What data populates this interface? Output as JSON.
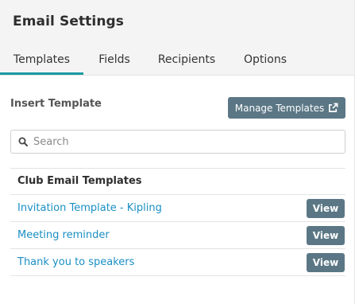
{
  "header": {
    "title": "Email Settings"
  },
  "tabs": [
    {
      "label": "Templates",
      "active": true
    },
    {
      "label": "Fields",
      "active": false
    },
    {
      "label": "Recipients",
      "active": false
    },
    {
      "label": "Options",
      "active": false
    }
  ],
  "insert_template": {
    "label": "Insert Template",
    "manage_button_label": "Manage Templates",
    "manage_button_icon": "external-link-icon"
  },
  "search": {
    "placeholder": "Search",
    "value": "",
    "icon": "search-icon"
  },
  "templates_table": {
    "header": "Club Email Templates",
    "rows": [
      {
        "name": "Invitation Template - Kipling",
        "action_label": "View"
      },
      {
        "name": "Meeting reminder",
        "action_label": "View"
      },
      {
        "name": "Thank you to speakers",
        "action_label": "View"
      }
    ]
  },
  "colors": {
    "accent_tab_underline": "#1a9aa6",
    "button_bg": "#5b7785",
    "link": "#1b8fc4",
    "header_bg": "#f4f4f4"
  }
}
